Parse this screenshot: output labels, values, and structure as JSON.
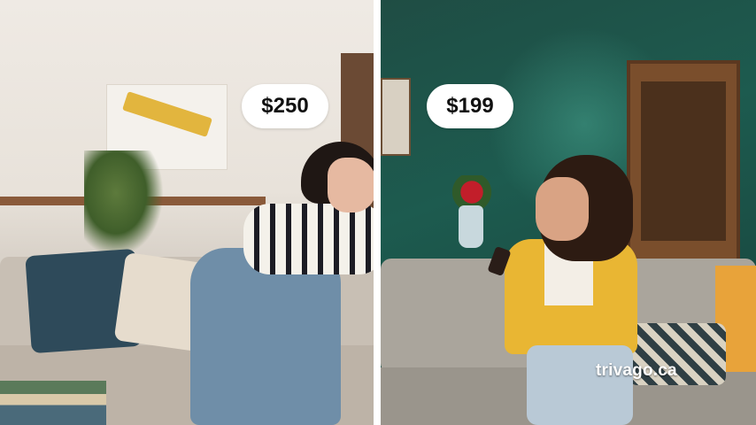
{
  "left_scene": {
    "price": "$250"
  },
  "right_scene": {
    "price": "$199"
  },
  "brand_text": "trivago.ca",
  "colors": {
    "badge_bg": "#ffffff",
    "badge_text": "#111111",
    "divider": "#ffffff",
    "brand": "#ffffff"
  }
}
